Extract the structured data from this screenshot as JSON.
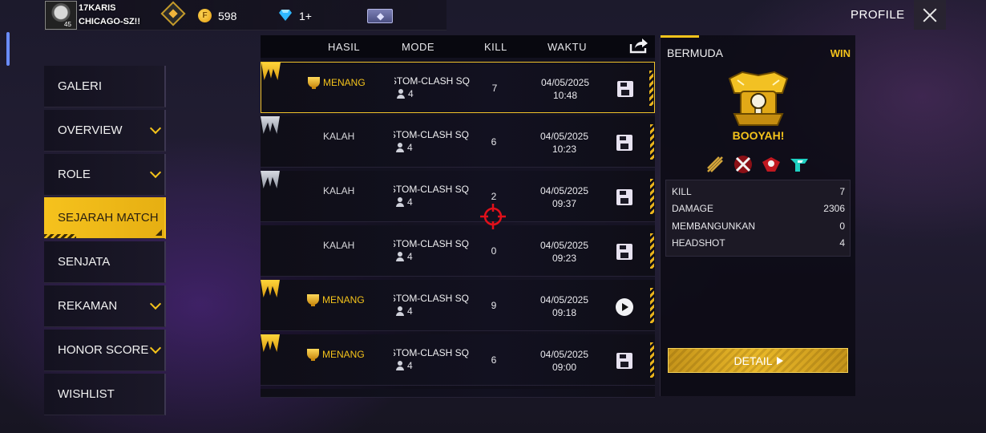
{
  "player": {
    "name": "17KARIS",
    "guild": "CHICAGO-SZ!!",
    "level": "45"
  },
  "currency": {
    "coins": "598",
    "diamonds": "1+"
  },
  "header": {
    "profile_label": "PROFILE"
  },
  "sidebar": {
    "items": [
      {
        "label": "GALERI",
        "has_chevron": false,
        "active": false
      },
      {
        "label": "OVERVIEW",
        "has_chevron": true,
        "active": false
      },
      {
        "label": "ROLE",
        "has_chevron": true,
        "active": false
      },
      {
        "label": "SEJARAH MATCH",
        "has_chevron": false,
        "active": true
      },
      {
        "label": "SENJATA",
        "has_chevron": false,
        "active": false
      },
      {
        "label": "REKAMAN",
        "has_chevron": true,
        "active": false
      },
      {
        "label": "HONOR SCORE",
        "has_chevron": true,
        "active": false
      },
      {
        "label": "WISHLIST",
        "has_chevron": false,
        "active": false
      }
    ]
  },
  "table": {
    "headers": {
      "result": "HASIL",
      "mode": "MODE",
      "kill": "KILL",
      "time": "WAKTU"
    },
    "rows": [
      {
        "result": "MENANG",
        "win": true,
        "mode": "CUSTOM-CLASH SQ",
        "team": "4",
        "kill": "7",
        "date": "04/05/2025",
        "time": "10:48",
        "action": "save",
        "selected": true
      },
      {
        "result": "KALAH",
        "win": false,
        "mode": "CUSTOM-CLASH SQ",
        "team": "4",
        "kill": "6",
        "date": "04/05/2025",
        "time": "10:23",
        "action": "save",
        "selected": false
      },
      {
        "result": "KALAH",
        "win": false,
        "mode": "CUSTOM-CLASH SQ",
        "team": "4",
        "kill": "2",
        "date": "04/05/2025",
        "time": "09:37",
        "action": "save",
        "selected": false
      },
      {
        "result": "KALAH",
        "win": false,
        "mode": "CUSTOM-CLASH SQ",
        "team": "4",
        "kill": "0",
        "date": "04/05/2025",
        "time": "09:23",
        "action": "save",
        "selected": false
      },
      {
        "result": "MENANG",
        "win": true,
        "mode": "CUSTOM-CLASH SQ",
        "team": "4",
        "kill": "9",
        "date": "04/05/2025",
        "time": "09:18",
        "action": "play",
        "selected": false
      },
      {
        "result": "MENANG",
        "win": true,
        "mode": "CUSTOM-CLASH SQ",
        "team": "4",
        "kill": "6",
        "date": "04/05/2025",
        "time": "09:00",
        "action": "save",
        "selected": false
      }
    ]
  },
  "detail": {
    "map": "BERMUDA",
    "outcome": "WIN",
    "booyah_label": "BOOYAH!",
    "stats": [
      {
        "label": "KILL",
        "value": "7"
      },
      {
        "label": "DAMAGE",
        "value": "2306"
      },
      {
        "label": "MEMBANGUNKAN",
        "value": "0"
      },
      {
        "label": "HEADSHOT",
        "value": "4"
      }
    ],
    "button_label": "DETAIL"
  },
  "colors": {
    "accent": "#f4c31b",
    "panel": "#12111c",
    "win": "#f4c31b",
    "lose": "#d8d8dc"
  }
}
